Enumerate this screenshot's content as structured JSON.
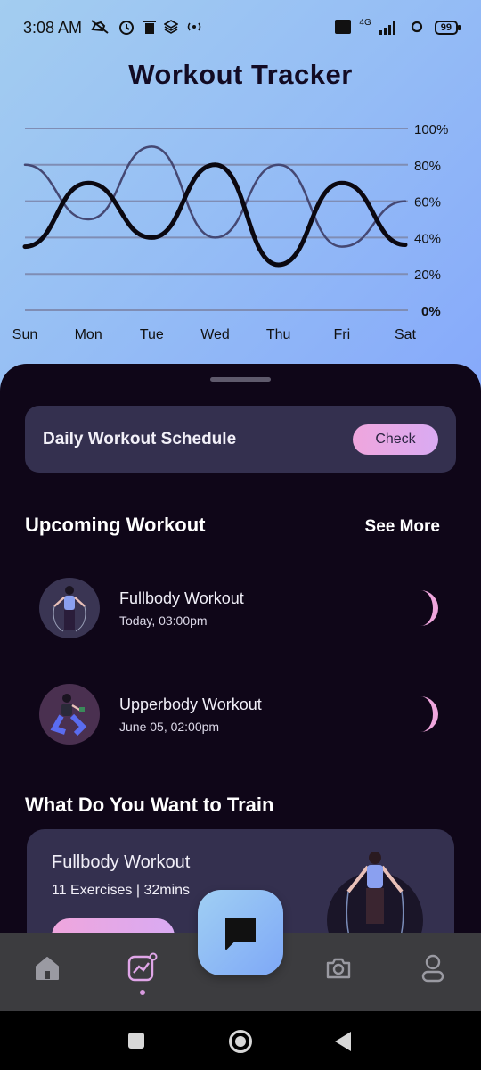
{
  "status_bar": {
    "time": "3:08 AM",
    "network": "4G",
    "battery": "99"
  },
  "header": {
    "title": "Workout Tracker"
  },
  "chart_data": {
    "type": "line",
    "categories": [
      "Sun",
      "Mon",
      "Tue",
      "Wed",
      "Thu",
      "Fri",
      "Sat"
    ],
    "y_ticks": [
      "100%",
      "80%",
      "60%",
      "40%",
      "20%",
      "0%"
    ],
    "ylim": [
      0,
      100
    ],
    "grid": true,
    "series": [
      {
        "values": [
          35,
          70,
          40,
          80,
          25,
          70,
          36
        ],
        "color": "#0b0810",
        "style": "thick"
      },
      {
        "values": [
          80,
          50,
          90,
          40,
          80,
          35,
          60
        ],
        "color": "#454873",
        "style": "thin"
      }
    ]
  },
  "schedule": {
    "label": "Daily Workout Schedule",
    "button_label": "Check"
  },
  "upcoming": {
    "title": "Upcoming Workout",
    "see_more": "See More",
    "items": [
      {
        "name": "Fullbody Workout",
        "time": "Today, 03:00pm"
      },
      {
        "name": "Upperbody Workout",
        "time": "June 05, 02:00pm"
      }
    ]
  },
  "train": {
    "title": "What Do You Want to Train",
    "card": {
      "name": "Fullbody Workout",
      "meta": "11 Exercises | 32mins"
    }
  },
  "colors": {
    "accent_pink": "#efa6dd",
    "card_bg": "#34304f",
    "sheet_bg": "#0f0618",
    "nav_bg": "#3c3c3f"
  },
  "nav": {
    "items": [
      "home-icon",
      "activity-icon",
      "chat-icon",
      "camera-icon",
      "profile-icon"
    ],
    "active": "activity-icon"
  }
}
